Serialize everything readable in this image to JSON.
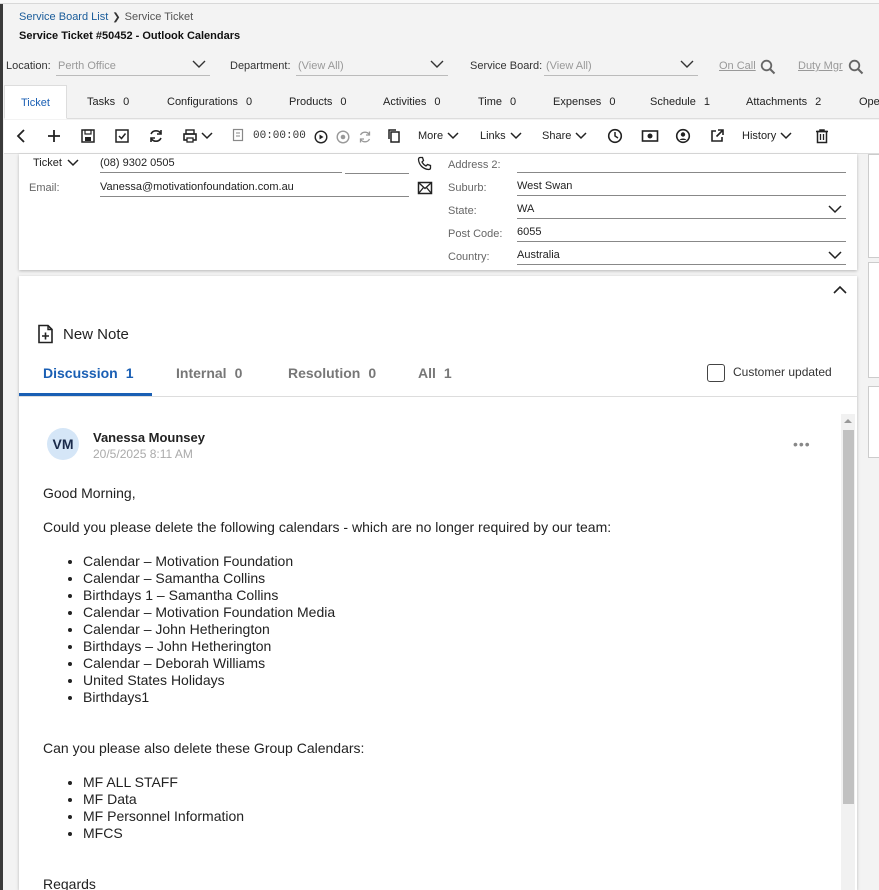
{
  "breadcrumb": {
    "root": "Service Board List",
    "current": "Service Ticket"
  },
  "page_title": "Service Ticket #50452 - Outlook Calendars",
  "filters": {
    "location_label": "Location:",
    "location_value": "Perth Office",
    "department_label": "Department:",
    "department_value": "(View All)",
    "board_label": "Service Board:",
    "board_value": "(View All)",
    "on_call": "On Call",
    "duty_mgr": "Duty Mgr"
  },
  "tabs": [
    {
      "label": "Ticket",
      "count": ""
    },
    {
      "label": "Tasks",
      "count": "0"
    },
    {
      "label": "Configurations",
      "count": "0"
    },
    {
      "label": "Products",
      "count": "0"
    },
    {
      "label": "Activities",
      "count": "0"
    },
    {
      "label": "Time",
      "count": "0"
    },
    {
      "label": "Expenses",
      "count": "0"
    },
    {
      "label": "Schedule",
      "count": "1"
    },
    {
      "label": "Attachments",
      "count": "2"
    },
    {
      "label": "Ope",
      "count": ""
    }
  ],
  "toolbar": {
    "timer": "00:00:00",
    "more": "More",
    "links": "Links",
    "share": "Share",
    "history": "History"
  },
  "contact": {
    "phone_type": "Ticket",
    "phone": "(08) 9302 0505",
    "email_label": "Email:",
    "email": "Vanessa@motivationfoundation.com.au",
    "address2_label": "Address 2:",
    "address2": "",
    "suburb_label": "Suburb:",
    "suburb": "West Swan",
    "state_label": "State:",
    "state": "WA",
    "postcode_label": "Post Code:",
    "postcode": "6055",
    "country_label": "Country:",
    "country": "Australia"
  },
  "notes": {
    "new_note": "New Note",
    "tabs": [
      {
        "label": "Discussion",
        "count": "1"
      },
      {
        "label": "Internal",
        "count": "0"
      },
      {
        "label": "Resolution",
        "count": "0"
      },
      {
        "label": "All",
        "count": "1"
      }
    ],
    "customer_updated": "Customer updated"
  },
  "message": {
    "initials": "VM",
    "author": "Vanessa Mounsey",
    "timestamp": "20/5/2025 8:11 AM",
    "greeting": "Good Morning,",
    "intro": "Could you please delete the following calendars - which are no longer required by our team:",
    "calendars": [
      "Calendar – Motivation Foundation",
      "Calendar – Samantha Collins",
      "Birthdays 1 – Samantha Collins",
      "Calendar – Motivation Foundation Media",
      "Calendar – John Hetherington",
      "Birthdays – John Hetherington",
      "Calendar – Deborah Williams",
      "United States Holidays",
      "Birthdays1"
    ],
    "group_intro": "Can you please also delete these Group Calendars:",
    "groups": [
      "MF ALL STAFF",
      "MF Data",
      "MF Personnel Information",
      "MFCS"
    ],
    "closing": "Regards"
  },
  "colors": {
    "accent": "#1a5fb4",
    "link": "#1a5c9a",
    "avatar_bg": "#d5e6f7"
  }
}
